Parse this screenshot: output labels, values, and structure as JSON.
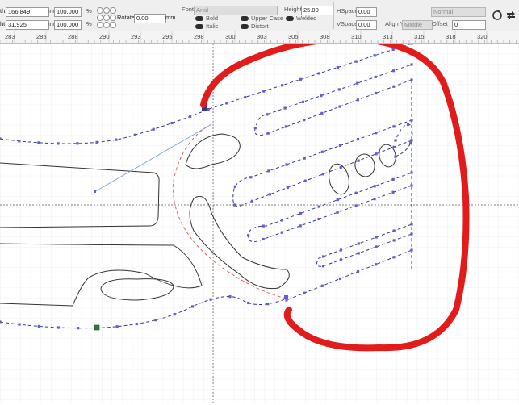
{
  "toolbar": {
    "width_label": "th",
    "width_value": "166.849",
    "height_label": "ht",
    "height_value": "31.925",
    "unit_mm": "mm",
    "scale_x_value": "100.000",
    "scale_y_value": "100.000",
    "percent": "%",
    "rotate_label": "Rotate",
    "rotate_value": "0.00",
    "rotate_unit": "mm",
    "font_label": "Font:",
    "font_value": "Arial",
    "bold_label": "Bold",
    "italic_label": "Italic",
    "upper_case_label": "Upper Case",
    "distort_label": "Distort",
    "welded_label": "Welded",
    "height_field_label": "Height",
    "height_field_value": "25.00",
    "hspace_label": "HSpace",
    "hspace_value": "0.00",
    "vspace_label": "VSpace",
    "vspace_value": "0.00",
    "align_y_label": "Align Y",
    "align_y_value": "Middle",
    "mode_value": "Normal",
    "offset_label": "Offset",
    "offset_value": "0"
  },
  "ruler": {
    "ticks": [
      "283",
      "285",
      "288",
      "290",
      "293",
      "295",
      "298",
      "300",
      "303",
      "305",
      "308",
      "310",
      "313",
      "315",
      "318",
      "320"
    ]
  },
  "colors": {
    "annotation_red": "#e21b1b",
    "path_blue": "#2c3c8c",
    "node_purple": "#6a5acd",
    "guide_red": "#e05050",
    "handle_blue": "#7ea6e0",
    "selected_node_green": "#2f7a3a"
  }
}
